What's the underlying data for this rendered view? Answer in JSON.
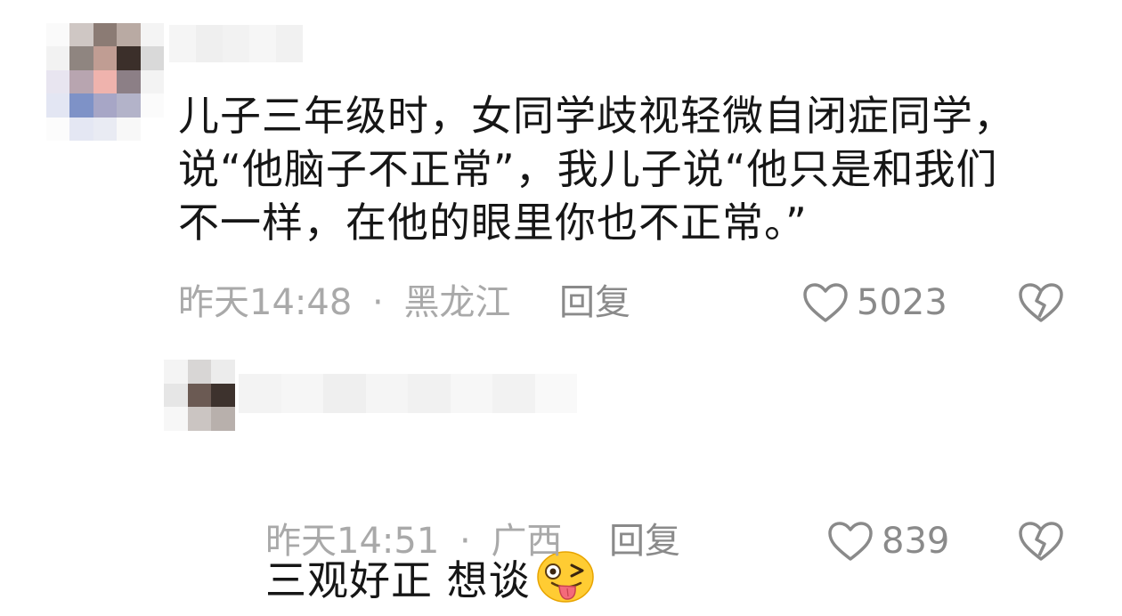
{
  "comments": [
    {
      "text": "儿子三年级时，女同学歧视轻微自闭症同学，\n说“他脑子不正常”，我儿子说“他只是和我们\n不一样，在他的眼里你也不正常。”",
      "time": "昨天14:48",
      "dot": "·",
      "location": "黑龙江",
      "reply_label": "回复",
      "likes": "5023",
      "like_icon": "heart-outline-icon",
      "dislike_icon": "broken-heart-icon"
    },
    {
      "text": "三观好正 想谈",
      "emoji": "winking-tongue-emoji",
      "time": "昨天14:51",
      "dot": "·",
      "location": "广西",
      "reply_label": "回复",
      "likes": "839",
      "like_icon": "heart-outline-icon",
      "dislike_icon": "broken-heart-icon"
    }
  ],
  "colors": {
    "text": "#161616",
    "meta": "#a9a9a9",
    "action": "#8a8a8a"
  }
}
